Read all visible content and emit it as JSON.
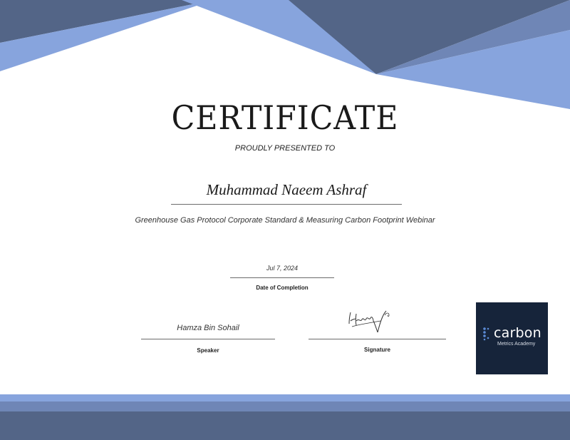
{
  "certificate": {
    "title": "CERTIFICATE",
    "presented_to": "PROUDLY PRESENTED TO",
    "recipient_name": "Muhammad Naeem Ashraf",
    "course_title": "Greenhouse Gas Protocol Corporate Standard & Measuring Carbon Footprint Webinar",
    "completion_date": "Jul 7, 2024",
    "date_caption": "Date of Completion",
    "speaker_name": "Hamza Bin Sohail",
    "speaker_caption": "Speaker",
    "signature_caption": "Signature"
  },
  "logo": {
    "word": "carbon",
    "subtitle": "Metrics Academy",
    "background": "#16243a",
    "accent": "#5b8bd6"
  },
  "colors": {
    "decor_dark": "#536587",
    "decor_light": "#87a4dd",
    "decor_mid": "#6f86b6"
  },
  "icons": {
    "signature": "handwritten-signature-icon",
    "logo_mark": "dot-cluster-icon"
  }
}
